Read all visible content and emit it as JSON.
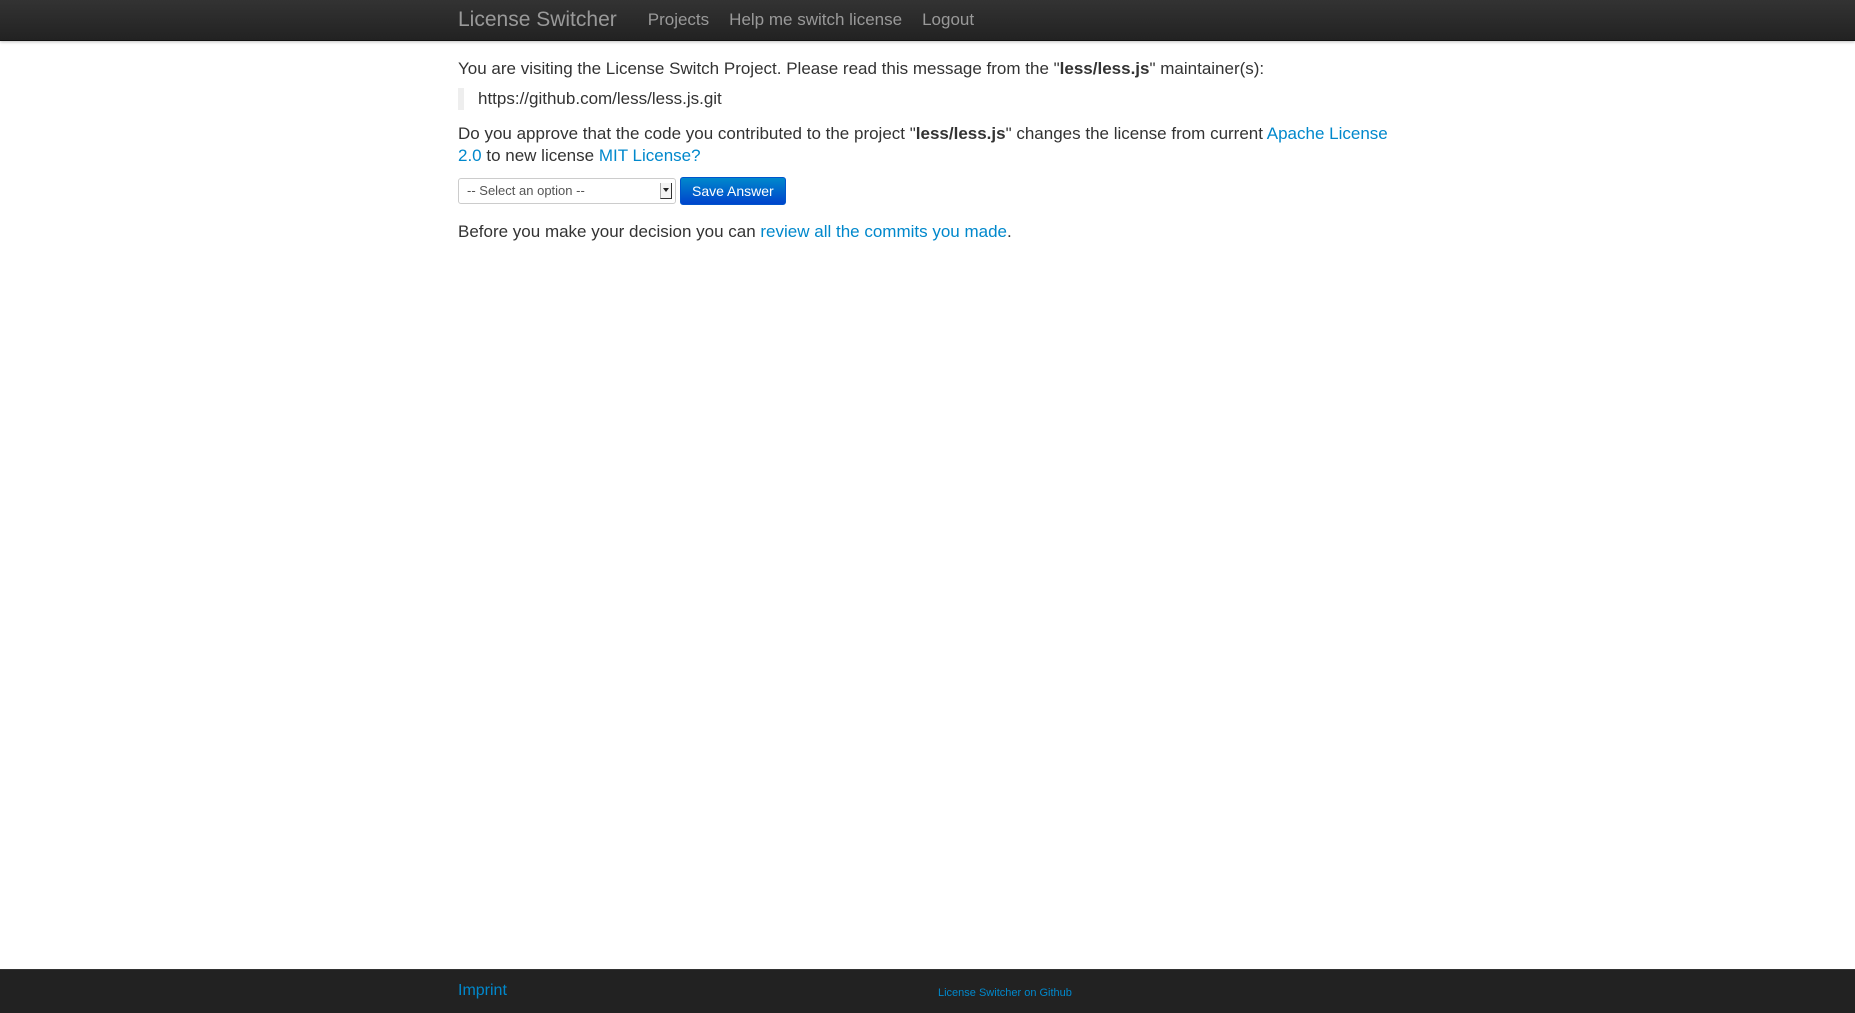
{
  "navbar": {
    "brand": "License Switcher",
    "links": [
      "Projects",
      "Help me switch license",
      "Logout"
    ]
  },
  "main": {
    "intro_prefix": "You are visiting the License Switch Project. Please read this message from the \"",
    "project_name": "less/less.js",
    "intro_suffix": "\" maintainer(s):",
    "maintainer_message": "https://github.com/less/less.js.git",
    "question_prefix": "Do you approve that the code you contributed to the project \"",
    "question_middle": "\" changes the license from current ",
    "current_license": "Apache License 2.0",
    "question_to": " to new license ",
    "new_license": "MIT License?",
    "select_value": "-- Select an option --",
    "save_button": "Save Answer",
    "review_prefix": "Before you make your decision you can ",
    "review_link": "review all the commits you made",
    "review_suffix": "."
  },
  "footer": {
    "imprint": "Imprint",
    "github_link": "License Switcher on Github"
  }
}
